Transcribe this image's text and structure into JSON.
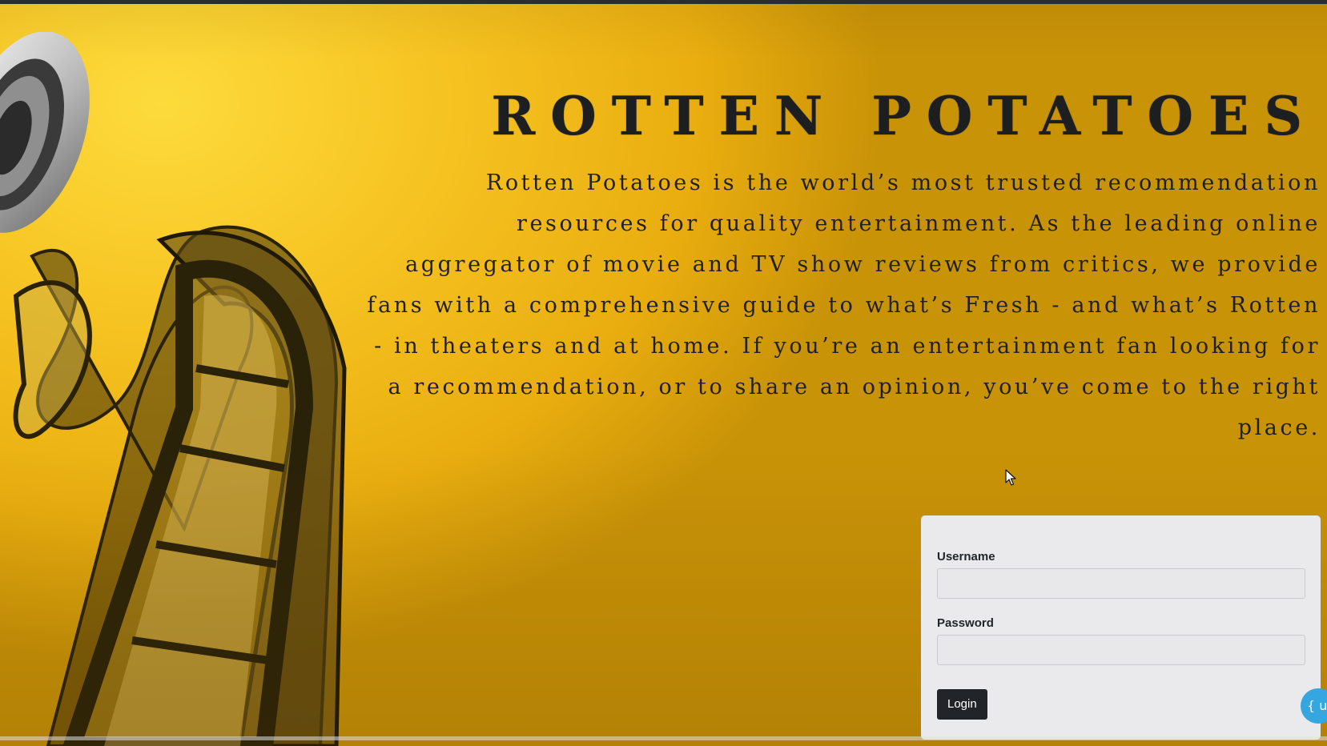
{
  "site": {
    "title": "ROTTEN POTATOES",
    "description": "Rotten Potatoes is the world’s most trusted recommendation resources for quality entertainment. As the leading online aggregator of movie and TV show reviews from critics, we provide fans with a comprehensive guide to what’s Fresh - and what’s Rotten - in theaters and at home. If you’re an entertainment fan looking for a recommendation, or to share an opinion, you’ve come to the right place."
  },
  "login": {
    "username_label": "Username",
    "username_value": "",
    "password_label": "Password",
    "password_value": "",
    "submit_label": "Login"
  },
  "floating_badge": {
    "text": "{ ui"
  },
  "decor": {
    "film_reel_icon": "film-reel-icon",
    "film_strip_icon": "film-strip-icon",
    "cursor_icon": "mouse-cursor-icon"
  },
  "colors": {
    "background_gold": "#f6c321",
    "title_text": "#1c1e20",
    "card_background": "#eaeaec",
    "button_background": "#212529",
    "badge_blue": "#36a6e0"
  }
}
